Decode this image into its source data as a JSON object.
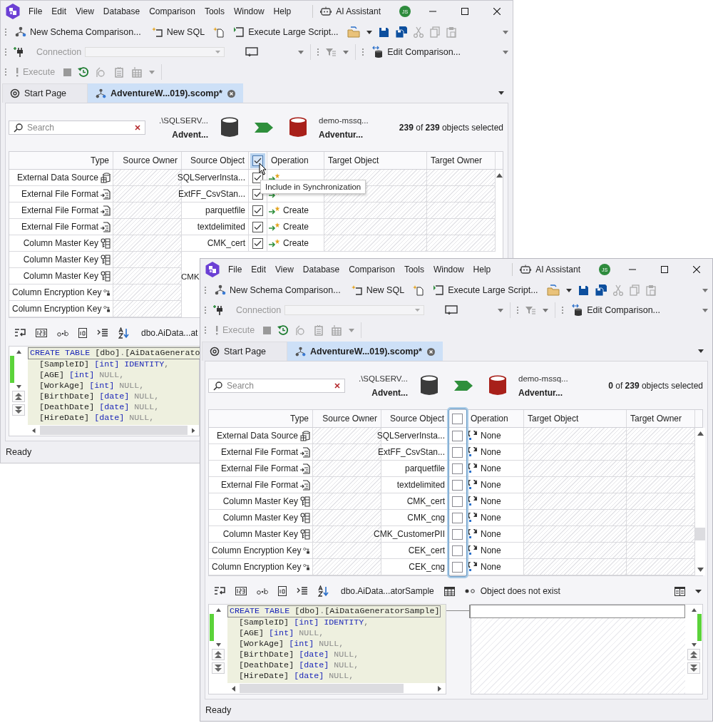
{
  "windows": [
    {
      "kind": "back",
      "menu": [
        "File",
        "Edit",
        "View",
        "Database",
        "Comparison",
        "Tools",
        "Window",
        "Help"
      ],
      "ai_assistant": "AI Assistant",
      "avatar": "JS",
      "toolbar1": {
        "new_schema": "New Schema Comparison...",
        "new_sql": "New SQL",
        "execute_large": "Execute Large Script...",
        "edit_buttons": [
          {
            "kind": "cut",
            "disabled": true
          },
          {
            "kind": "copy",
            "disabled": true
          },
          {
            "kind": "paste",
            "disabled": true
          }
        ]
      },
      "toolbar2": {
        "connection": {
          "label": "Connection",
          "disabled": true
        },
        "edit_comparison": "Edit Comparison..."
      },
      "toolbar3": {
        "execute": {
          "label": "Execute",
          "disabled": true
        }
      },
      "tabs": [
        {
          "kind": "start",
          "label": "Start Page",
          "selected": false
        },
        {
          "kind": "comparison",
          "label": "AdventureW...019).scomp*",
          "selected": true
        }
      ],
      "search": {
        "placeholder": "Search"
      },
      "source": {
        "server": ".\\SQLSERV...",
        "database": "Advent..."
      },
      "target": {
        "server": "demo-mssq...",
        "database": "Adventur..."
      },
      "selection": "**239** of **239** objects selected",
      "grid": {
        "columns": [
          "Type",
          "Source Owner",
          "Source Object",
          "Operation",
          "Target Object",
          "Target Owner"
        ],
        "header_checked": true,
        "rows": [
          {
            "type": {
              "label": "External Data Source",
              "kind": "data_source"
            },
            "source_object": "SQLServerInsta...",
            "checked": true,
            "operation": {
              "kind": "create"
            }
          },
          {
            "type": {
              "label": "External File Format",
              "kind": "file_format"
            },
            "source_object": "ExtFF_CsvStan...",
            "checked": true,
            "operation": {
              "kind": "create"
            }
          },
          {
            "type": {
              "label": "External File Format",
              "kind": "file_format"
            },
            "source_object": "parquetfile",
            "checked": true,
            "operation": {
              "label": "Create",
              "kind": "create"
            }
          },
          {
            "type": {
              "label": "External File Format",
              "kind": "file_format"
            },
            "source_object": "textdelimited",
            "checked": true,
            "operation": {
              "label": "Create",
              "kind": "create"
            }
          },
          {
            "type": {
              "label": "Column Master Key",
              "kind": "master_key"
            },
            "source_object": "CMK_cert",
            "checked": true,
            "operation": {
              "label": "Create",
              "kind": "create"
            }
          },
          {
            "type": {
              "label": "Column Master Key",
              "kind": "master_key"
            }
          },
          {
            "type": {
              "label": "Column Master Key",
              "kind": "master_key"
            },
            "source_object": "CMK"
          },
          {
            "type": {
              "label": "Column Encryption Key",
              "kind": "encryption_key"
            }
          },
          {
            "type": {
              "label": "Column Encryption Key",
              "kind": "encryption_key"
            }
          }
        ]
      },
      "tooltip": "Include in Synchronization",
      "editor": {
        "object": "dbo.AiData...at",
        "code": [
          [
            {
              "text": "CREATE TABLE ",
              "kind": "keyword"
            },
            {
              "text": "[dbo]",
              "kind": "name"
            },
            {
              "text": ".",
              "kind": "punctuation"
            },
            {
              "text": "[AiDataGenerato",
              "kind": "name"
            }
          ],
          [
            {
              "text": "[SampleID] ",
              "kind": "name"
            },
            {
              "text": "[int] IDENTITY",
              "kind": "keyword"
            },
            {
              "text": ",",
              "kind": "punctuation"
            }
          ],
          [
            {
              "text": "[AGE] ",
              "kind": "name"
            },
            {
              "text": "[int]",
              "kind": "keyword"
            },
            {
              "text": " NULL,",
              "kind": "null"
            }
          ],
          [
            {
              "text": "[WorkAge] ",
              "kind": "name"
            },
            {
              "text": "[int]",
              "kind": "keyword"
            },
            {
              "text": " NULL,",
              "kind": "null"
            }
          ],
          [
            {
              "text": "[BirthDate] ",
              "kind": "name"
            },
            {
              "text": "[date]",
              "kind": "keyword"
            },
            {
              "text": " NULL,",
              "kind": "null"
            }
          ],
          [
            {
              "text": "[DeathDate] ",
              "kind": "name"
            },
            {
              "text": "[date]",
              "kind": "keyword"
            },
            {
              "text": " NULL,",
              "kind": "null"
            }
          ],
          [
            {
              "text": "[HireDate] ",
              "kind": "name"
            },
            {
              "text": "[date]",
              "kind": "keyword"
            },
            {
              "text": " NULL,",
              "kind": "null"
            }
          ]
        ]
      },
      "status": "Ready"
    },
    {
      "kind": "front",
      "menu": [
        "File",
        "Edit",
        "View",
        "Database",
        "Comparison",
        "Tools",
        "Window",
        "Help"
      ],
      "ai_assistant": "AI Assistant",
      "avatar": "JS",
      "toolbar1": {
        "new_schema": "New Schema Comparison...",
        "new_sql": "New SQL",
        "execute_large": "Execute Large Script...",
        "edit_buttons": [
          {
            "kind": "cut",
            "disabled": true
          },
          {
            "kind": "copy",
            "disabled": true
          },
          {
            "kind": "paste",
            "disabled": true
          }
        ]
      },
      "toolbar2": {
        "connection": {
          "label": "Connection",
          "disabled": true
        },
        "edit_comparison": "Edit Comparison..."
      },
      "toolbar3": {
        "execute": {
          "label": "Execute",
          "disabled": true
        }
      },
      "tabs": [
        {
          "kind": "start",
          "label": "Start Page",
          "selected": false
        },
        {
          "kind": "comparison",
          "label": "AdventureW...019).scomp*",
          "selected": true
        }
      ],
      "search": {
        "placeholder": "Search"
      },
      "source": {
        "server": ".\\SQLSERV...",
        "database": "Advent..."
      },
      "target": {
        "server": "demo-mssq...",
        "database": "Adventur..."
      },
      "selection": "**0** of **239** objects selected",
      "grid": {
        "columns": [
          "Type",
          "Source Owner",
          "Source Object",
          "Operation",
          "Target Object",
          "Target Owner"
        ],
        "header_checked": false,
        "include_column_highlighted": true,
        "rows": [
          {
            "type": {
              "label": "External Data Source",
              "kind": "data_source"
            },
            "source_object": "SQLServerInsta...",
            "checked": false,
            "operation": {
              "label": "None",
              "kind": "none"
            }
          },
          {
            "type": {
              "label": "External File Format",
              "kind": "file_format"
            },
            "source_object": "ExtFF_CsvStan...",
            "checked": false,
            "operation": {
              "label": "None",
              "kind": "none"
            }
          },
          {
            "type": {
              "label": "External File Format",
              "kind": "file_format"
            },
            "source_object": "parquetfile",
            "checked": false,
            "operation": {
              "label": "None",
              "kind": "none"
            }
          },
          {
            "type": {
              "label": "External File Format",
              "kind": "file_format"
            },
            "source_object": "textdelimited",
            "checked": false,
            "operation": {
              "label": "None",
              "kind": "none"
            }
          },
          {
            "type": {
              "label": "Column Master Key",
              "kind": "master_key"
            },
            "source_object": "CMK_cert",
            "checked": false,
            "operation": {
              "label": "None",
              "kind": "none"
            }
          },
          {
            "type": {
              "label": "Column Master Key",
              "kind": "master_key"
            },
            "source_object": "CMK_cng",
            "checked": false,
            "operation": {
              "label": "None",
              "kind": "none"
            }
          },
          {
            "type": {
              "label": "Column Master Key",
              "kind": "master_key"
            },
            "source_object": "CMK_CustomerPII",
            "checked": false,
            "operation": {
              "label": "None",
              "kind": "none"
            }
          },
          {
            "type": {
              "label": "Column Encryption Key",
              "kind": "encryption_key"
            },
            "source_object": "CEK_cert",
            "checked": false,
            "operation": {
              "label": "None",
              "kind": "none"
            }
          },
          {
            "type": {
              "label": "Column Encryption Key",
              "kind": "encryption_key"
            },
            "source_object": "CEK_cng",
            "checked": false,
            "operation": {
              "label": "None",
              "kind": "none"
            }
          }
        ]
      },
      "editor": {
        "object": "dbo.AiData...atorSample",
        "target_status": "Object does not exist",
        "code": [
          [
            {
              "text": "CREATE TABLE ",
              "kind": "keyword"
            },
            {
              "text": "[dbo]",
              "kind": "name"
            },
            {
              "text": ".",
              "kind": "punctuation"
            },
            {
              "text": "[AiDataGeneratorSample]",
              "kind": "name"
            }
          ],
          [
            {
              "text": "[SampleID] ",
              "kind": "name"
            },
            {
              "text": "[int] IDENTITY",
              "kind": "keyword"
            },
            {
              "text": ",",
              "kind": "punctuation"
            }
          ],
          [
            {
              "text": "[AGE] ",
              "kind": "name"
            },
            {
              "text": "[int]",
              "kind": "keyword"
            },
            {
              "text": " NULL,",
              "kind": "null"
            }
          ],
          [
            {
              "text": "[WorkAge] ",
              "kind": "name"
            },
            {
              "text": "[int]",
              "kind": "keyword"
            },
            {
              "text": " NULL,",
              "kind": "null"
            }
          ],
          [
            {
              "text": "[BirthDate] ",
              "kind": "name"
            },
            {
              "text": "[date]",
              "kind": "keyword"
            },
            {
              "text": " NULL,",
              "kind": "null"
            }
          ],
          [
            {
              "text": "[DeathDate] ",
              "kind": "name"
            },
            {
              "text": "[date]",
              "kind": "keyword"
            },
            {
              "text": " NULL,",
              "kind": "null"
            }
          ],
          [
            {
              "text": "[HireDate] ",
              "kind": "name"
            },
            {
              "text": "[date]",
              "kind": "keyword"
            },
            {
              "text": " NULL,",
              "kind": "null"
            }
          ]
        ]
      },
      "status": "Ready"
    }
  ]
}
